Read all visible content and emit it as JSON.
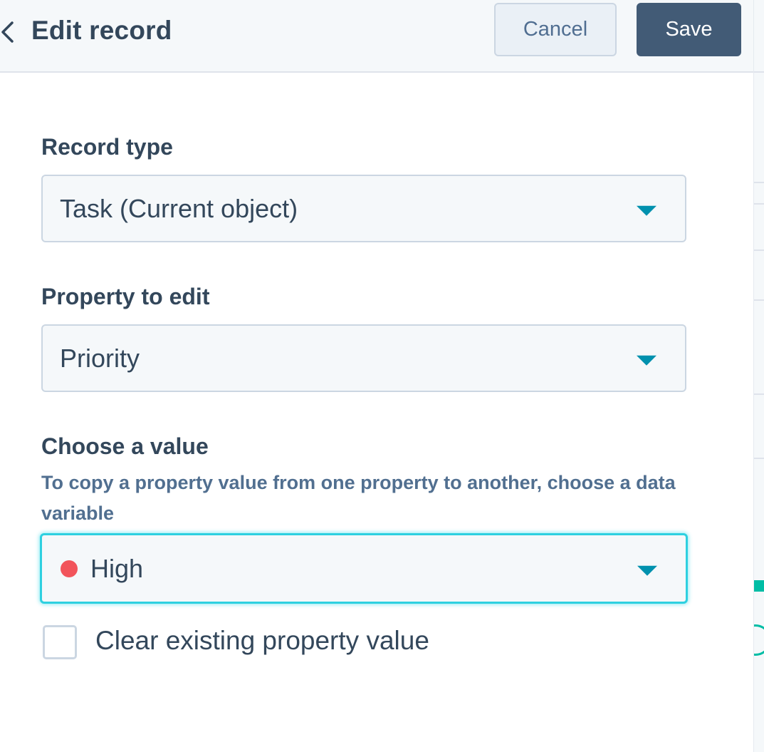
{
  "header": {
    "title": "Edit record",
    "cancel_label": "Cancel",
    "save_label": "Save"
  },
  "fields": {
    "record_type": {
      "label": "Record type",
      "value": "Task (Current object)"
    },
    "property": {
      "label": "Property to edit",
      "value": "Priority"
    },
    "value": {
      "label": "Choose a value",
      "help": "To copy a property value from one property to another, choose a data variable",
      "selected": "High",
      "status_color": "#f2545b"
    },
    "clear_existing": {
      "label": "Clear existing property value",
      "checked": false
    }
  },
  "colors": {
    "accent": "#0091ae",
    "focus": "#2ed0e0",
    "primary_button": "#425b76",
    "text": "#33475b"
  }
}
